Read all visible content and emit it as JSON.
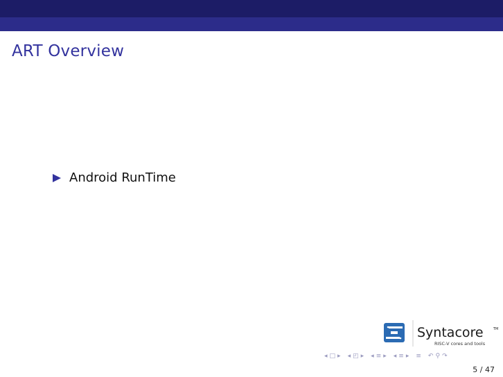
{
  "header": {
    "colors": {
      "top": "#1c1c66",
      "bottom": "#2c2c8a"
    }
  },
  "frame": {
    "title": "ART Overview",
    "title_color": "#33339e"
  },
  "content": {
    "bullets": [
      {
        "text": "Android RunTime",
        "marker": "triangle-bullet-icon"
      }
    ]
  },
  "logo": {
    "name": "Syntacore",
    "tagline": "RISC-V cores and tools",
    "trademark": "TM",
    "accent": "#2b6bb3"
  },
  "navigation": {
    "icons": [
      "nav-prev-icon",
      "nav-frame-icon",
      "nav-next-icon",
      "nav-prev-icon",
      "nav-subsection-icon",
      "nav-next-icon",
      "nav-prev-icon",
      "nav-section-icon",
      "nav-next-icon",
      "nav-prev-icon",
      "nav-section-icon",
      "nav-next-icon",
      "nav-align-icon",
      "nav-back-icon",
      "nav-search-icon",
      "nav-forward-icon"
    ],
    "page": "5 / 47"
  }
}
